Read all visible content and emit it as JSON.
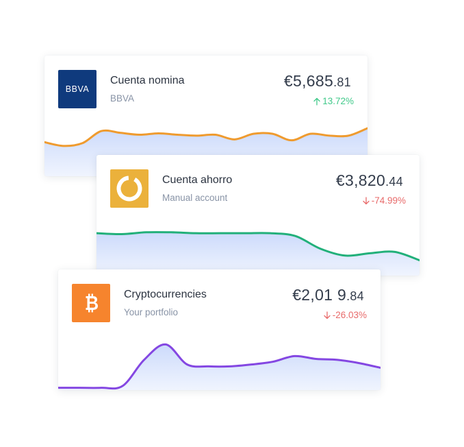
{
  "accounts": [
    {
      "name": "Cuenta nomina",
      "subtitle": "BBVA",
      "logo": {
        "type": "bank-logo",
        "text": "BBVA",
        "bg": "#0f3a7d",
        "fg": "#ffffff"
      },
      "amount_main": "€5,685",
      "amount_cents": ".81",
      "change": "13.72%",
      "change_direction": "up",
      "change_color": "#41c98a",
      "line_color": "#ef9b2f",
      "trend": [
        0.7,
        0.62,
        0.68,
        0.94,
        0.9,
        0.86,
        0.89,
        0.86,
        0.84,
        0.86,
        0.76,
        0.88,
        0.88,
        0.74,
        0.88,
        0.84,
        0.84,
        1.0
      ]
    },
    {
      "name": "Cuenta ahorro",
      "subtitle": "Manual account",
      "logo": {
        "type": "ring-icon",
        "bg": "#ebb13b",
        "fg": "#ffffff"
      },
      "amount_main": "€3,820",
      "amount_cents": ".44",
      "change": "-74.99%",
      "change_direction": "down",
      "change_color": "#e86a6a",
      "line_color": "#22b07a",
      "trend": [
        0.88,
        0.86,
        0.9,
        0.9,
        0.88,
        0.88,
        0.88,
        0.88,
        0.82,
        0.55,
        0.4,
        0.45,
        0.48,
        0.3
      ]
    },
    {
      "name": "Cryptocurrencies",
      "subtitle": "Your portfolio",
      "logo": {
        "type": "bitcoin-icon",
        "bg": "#f6842d",
        "fg": "#ffffff"
      },
      "amount_main": "€2,01 9",
      "amount_cents": ".84",
      "change": "-26.03%",
      "change_direction": "down",
      "change_color": "#e86a6a",
      "line_color": "#8447e2",
      "trend": [
        0.02,
        0.02,
        0.02,
        0.06,
        0.62,
        0.95,
        0.52,
        0.48,
        0.48,
        0.52,
        0.58,
        0.7,
        0.64,
        0.62,
        0.55,
        0.45
      ]
    }
  ]
}
